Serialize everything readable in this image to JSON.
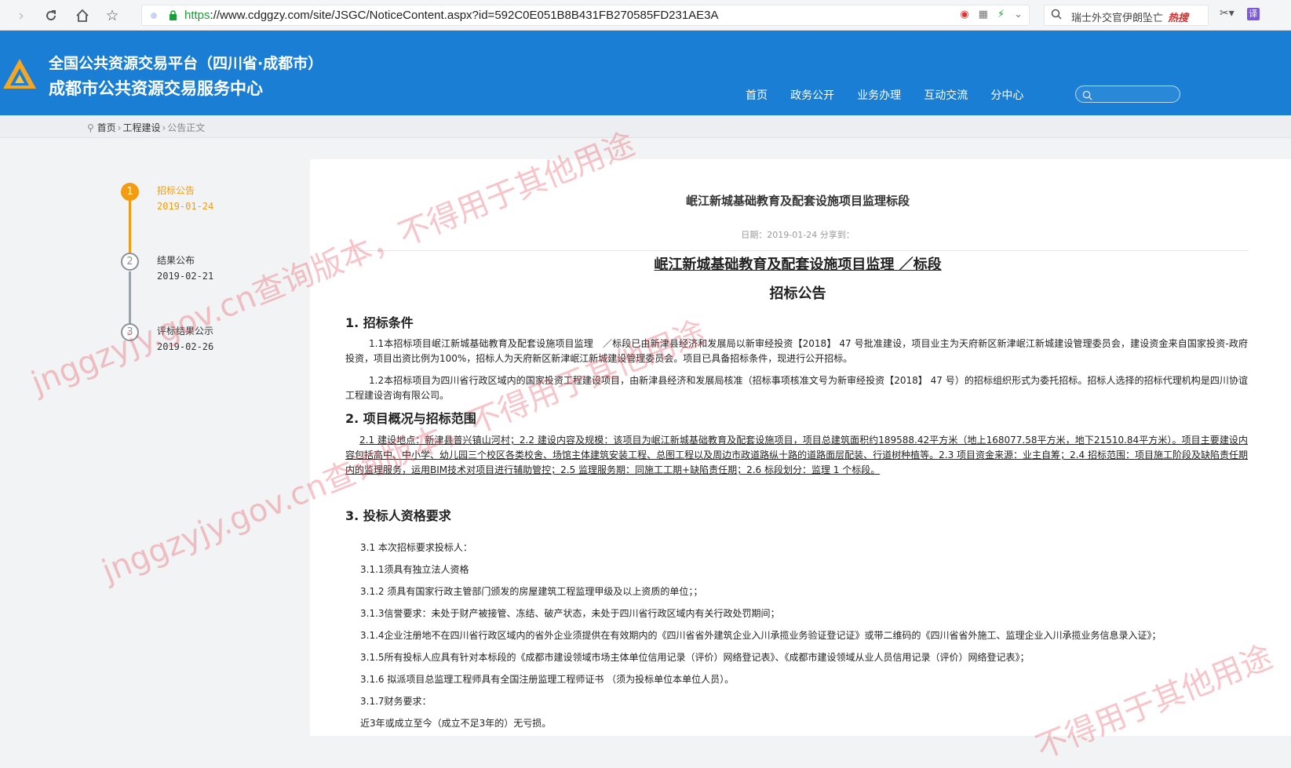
{
  "browser": {
    "url_scheme": "https",
    "url_rest": "://www.cdggzy.com/site/JSGC/NoticeContent.aspx?id=592C0E051B8B431FB270585FD231AE3A",
    "search_hint": "瑞士外交官伊朗坠亡",
    "search_hot": "热搜",
    "translate_label": "译"
  },
  "header": {
    "title_line1": "全国公共资源交易平台（四川省·成都市）",
    "title_line2": "成都市公共资源交易服务中心",
    "nav": [
      "首页",
      "政务公开",
      "业务办理",
      "互动交流",
      "分中心"
    ],
    "search_placeholder": ""
  },
  "breadcrumb": {
    "home": "首页",
    "section": "工程建设",
    "current": "公告正文"
  },
  "timeline": [
    {
      "num": "1",
      "label": "招标公告",
      "date": "2019-01-24",
      "active": true
    },
    {
      "num": "2",
      "label": "结果公布",
      "date": "2019-02-21",
      "active": false
    },
    {
      "num": "3",
      "label": "评标结果公示",
      "date": "2019-02-26",
      "active": false
    }
  ],
  "content": {
    "title": "岷江新城基础教育及配套设施项目监理标段",
    "meta": "日期：2019-01-24  分享到：",
    "doc_title": "岷江新城基础教育及配套设施项目监理 ／标段",
    "doc_subtitle": "招标公告",
    "sec1": "1. 招标条件",
    "p1_1": "1.1本招标项目岷江新城基础教育及配套设施项目监理　／标段已由新津县经济和发展局以新审经投资【2018】 47 号批准建设，项目业主为天府新区新津岷江新城建设管理委员会，建设资金来自国家投资-政府投资，项目出资比例为100%，招标人为天府新区新津岷江新城建设管理委员会。项目已具备招标条件，现进行公开招标。",
    "p1_2": "1.2本招标项目为四川省行政区域内的国家投资工程建设项目，由新津县经济和发展局核准（招标事项核准文号为新审经投资【2018】 47 号）的招标组织形式为委托招标。招标人选择的招标代理机构是四川协谊工程建设咨询有限公司。",
    "sec2": "2. 项目概况与招标范围",
    "p2": "2.1 建设地点：新津县普兴镇山河村；2.2 建设内容及规模：该项目为岷江新城基础教育及配套设施项目，项目总建筑面积约189588.42平方米（地上168077.58平方米，地下21510.84平方米）。项目主要建设内容包括高中、中小学、幼儿园三个校区各类校舍、场馆主体建筑安装工程、总图工程以及周边市政道路纵十路的道路面层配装、行道树种植等。2.3 项目资金来源：业主自筹；2.4 招标范围：项目施工阶段及缺陷责任期内的监理服务，运用BIM技术对项目进行辅助管控；2.5 监理服务期：同施工工期+缺陷责任期；2.6 标段划分：监理 1 个标段。",
    "sec3": "3. 投标人资格要求",
    "reqs": [
      "3.1 本次招标要求投标人：",
      "3.1.1须具有独立法人资格",
      "3.1.2 须具有国家行政主管部门颁发的房屋建筑工程监理甲级及以上资质的单位；；",
      "3.1.3信誉要求：未处于财产被接管、冻结、破产状态，未处于四川省行政区域内有关行政处罚期间；",
      "3.1.4企业注册地不在四川省行政区域内的省外企业须提供在有效期内的《四川省省外建筑企业入川承揽业务验证登记证》或带二维码的《四川省省外施工、监理企业入川承揽业务信息录入证》；",
      "3.1.5所有投标人应具有针对本标段的《成都市建设领域市场主体单位信用记录（评价）网络登记表》、《成都市建设领域从业人员信用记录（评价）网络登记表》；",
      "3.1.6 拟派项目总监理工程师具有全国注册监理工程师证书 （须为投标单位本单位人员）。",
      "3.1.7财务要求：",
      "近3年或成立至今（成立不足3年的）无亏损。"
    ]
  },
  "watermarks": [
    "jnggzyjy.gov.cn查询版本，不得用于其他用途",
    "jnggzyjy.gov.cn查询版本，不得用于其他用途",
    "不得用于其他用途"
  ],
  "colors": {
    "header_blue": "#1a7ed4",
    "accent_orange": "#f39c12",
    "watermark": "#e85a64"
  }
}
